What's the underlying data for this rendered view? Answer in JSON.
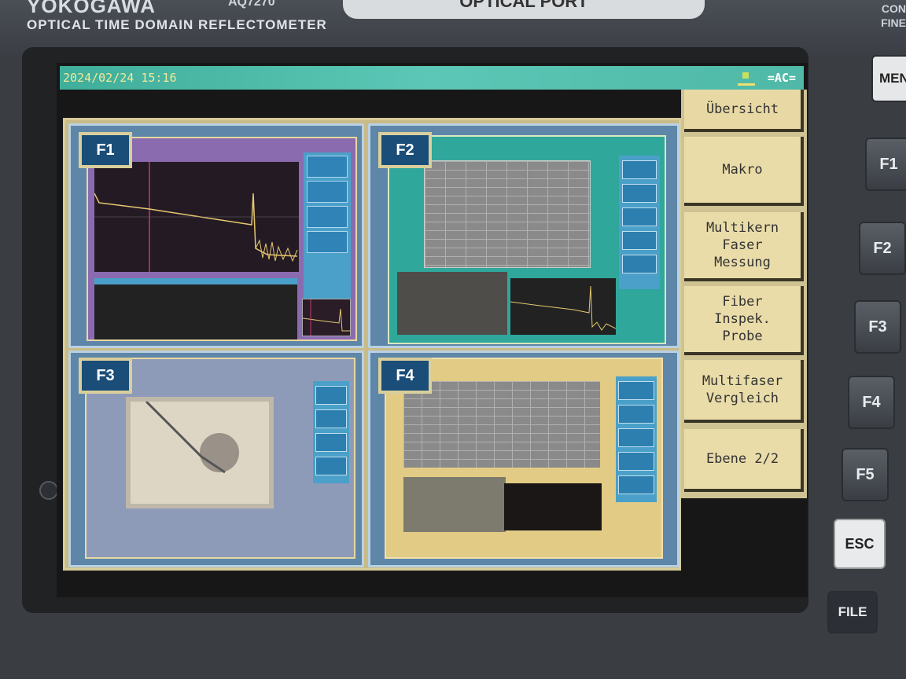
{
  "device": {
    "brand": "YOKOGAWA",
    "model": "AQ7270",
    "subtitle": "OPTICAL TIME DOMAIN REFLECTOMETER",
    "port_label": "OPTICAL PORT",
    "side_label": "CON FINE"
  },
  "status_bar": {
    "datetime": "2024/02/24 15:16",
    "power_label": "=AC="
  },
  "quadrants": [
    {
      "key": "F1"
    },
    {
      "key": "F2"
    },
    {
      "key": "F3"
    },
    {
      "key": "F4"
    }
  ],
  "softkeys": [
    {
      "label": "Übersicht"
    },
    {
      "label": "Makro"
    },
    {
      "label": "Multikern\nFaser\nMessung"
    },
    {
      "label": "Fiber\nInspek.\nProbe"
    },
    {
      "label": "Multifaser\nVergleich"
    },
    {
      "label": "Ebene 2/2"
    }
  ],
  "hardware_buttons": {
    "menu": "MEN",
    "f1": "F1",
    "f2": "F2",
    "f3": "F3",
    "f4": "F4",
    "f5": "F5",
    "esc": "ESC",
    "file": "FILE"
  }
}
